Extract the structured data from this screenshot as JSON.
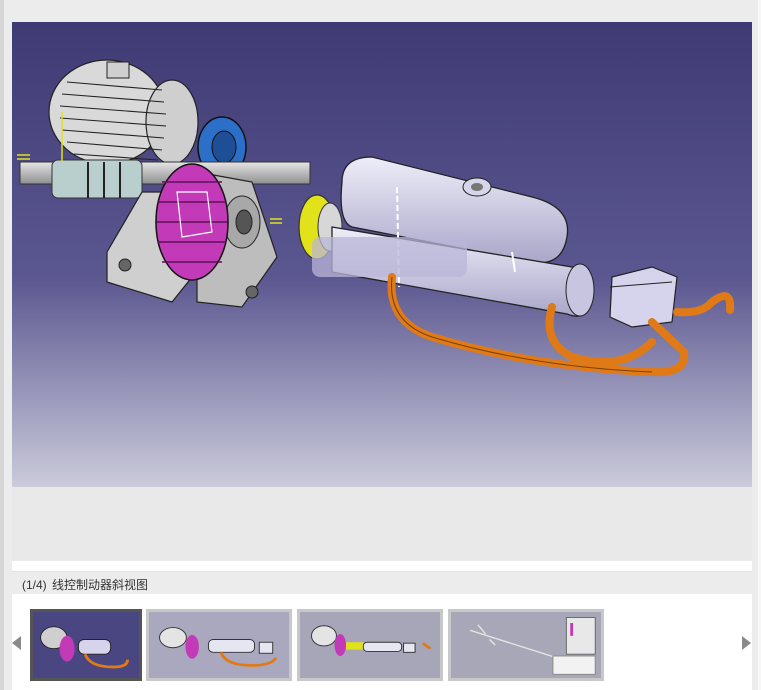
{
  "caption": {
    "counter": "(1/4)",
    "title": "线控制动器斜视图"
  },
  "viewer": {
    "background_top": "#3f3a74",
    "background_bottom": "#c8c8d8"
  },
  "thumbnails": [
    {
      "index": 1,
      "selected": true
    },
    {
      "index": 2,
      "selected": false
    },
    {
      "index": 3,
      "selected": false
    },
    {
      "index": 4,
      "selected": false
    }
  ],
  "icons": {
    "prev": "triangle-left-icon",
    "next": "triangle-right-icon"
  },
  "colors": {
    "gear_magenta": "#c23ab7",
    "gear_blue": "#2b6fc9",
    "pipe_orange": "#e07a16",
    "coupling_yellow": "#e2e21a",
    "body_lavender": "#d6d3ec"
  }
}
